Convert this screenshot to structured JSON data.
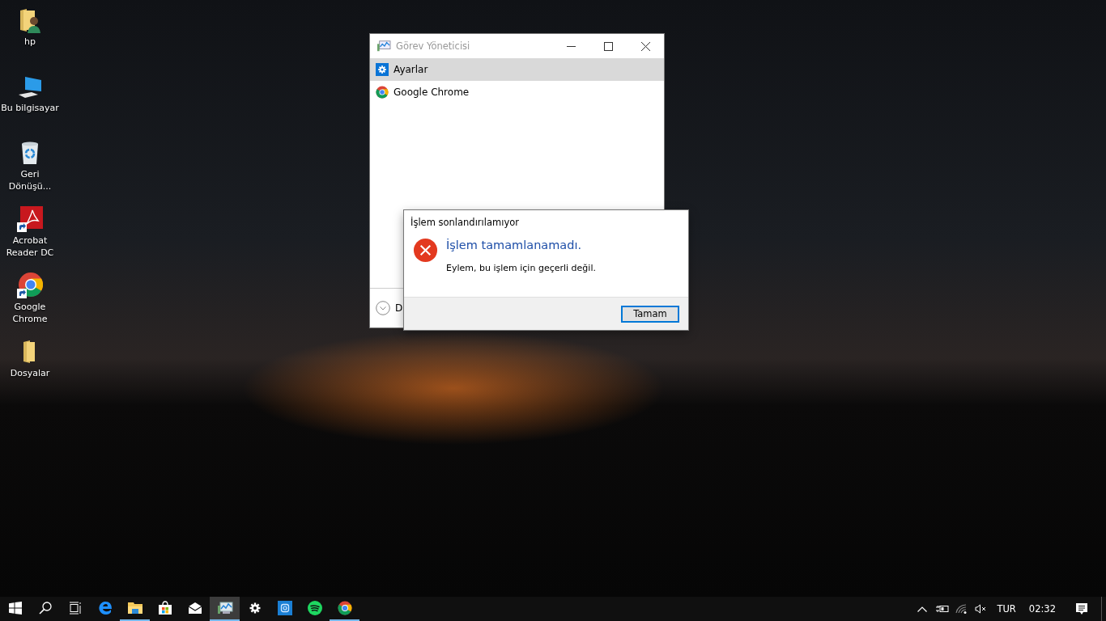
{
  "desktop_icons": [
    {
      "kind": "user-folder",
      "lines": [
        "hp"
      ]
    },
    {
      "kind": "computer",
      "lines": [
        "Bu bilgisayar"
      ]
    },
    {
      "kind": "recycle-bin",
      "lines": [
        "Geri",
        "Dönüşü..."
      ]
    },
    {
      "kind": "pdf",
      "lines": [
        "Acrobat",
        "Reader DC"
      ]
    },
    {
      "kind": "chrome",
      "lines": [
        "Google",
        "Chrome"
      ]
    },
    {
      "kind": "folder",
      "lines": [
        "Dosyalar"
      ]
    }
  ],
  "task_manager": {
    "title": "Görev Yöneticisi",
    "items": [
      {
        "kind": "settings",
        "label": "Ayarlar",
        "selected": true
      },
      {
        "kind": "chrome",
        "label": "Google Chrome",
        "selected": false
      }
    ],
    "footer_text": "D"
  },
  "dialog": {
    "title": "İşlem sonlandırılamıyor",
    "instruction": "İşlem tamamlanamadı.",
    "content": "Eylem, bu işlem için geçerli değil.",
    "button": "Tamam"
  },
  "taskbar": {
    "apps": [
      {
        "kind": "edge",
        "running": false,
        "selected": false
      },
      {
        "kind": "explorer",
        "running": true,
        "selected": false
      },
      {
        "kind": "store",
        "running": false,
        "selected": false
      },
      {
        "kind": "mail",
        "running": false,
        "selected": false
      },
      {
        "kind": "taskmgr",
        "running": true,
        "selected": true
      },
      {
        "kind": "settings",
        "running": false,
        "selected": false
      },
      {
        "kind": "app",
        "running": false,
        "selected": false
      },
      {
        "kind": "spotify",
        "running": false,
        "selected": false
      },
      {
        "kind": "chrome",
        "running": true,
        "selected": false
      }
    ],
    "language": "TUR",
    "time": "02:32"
  }
}
